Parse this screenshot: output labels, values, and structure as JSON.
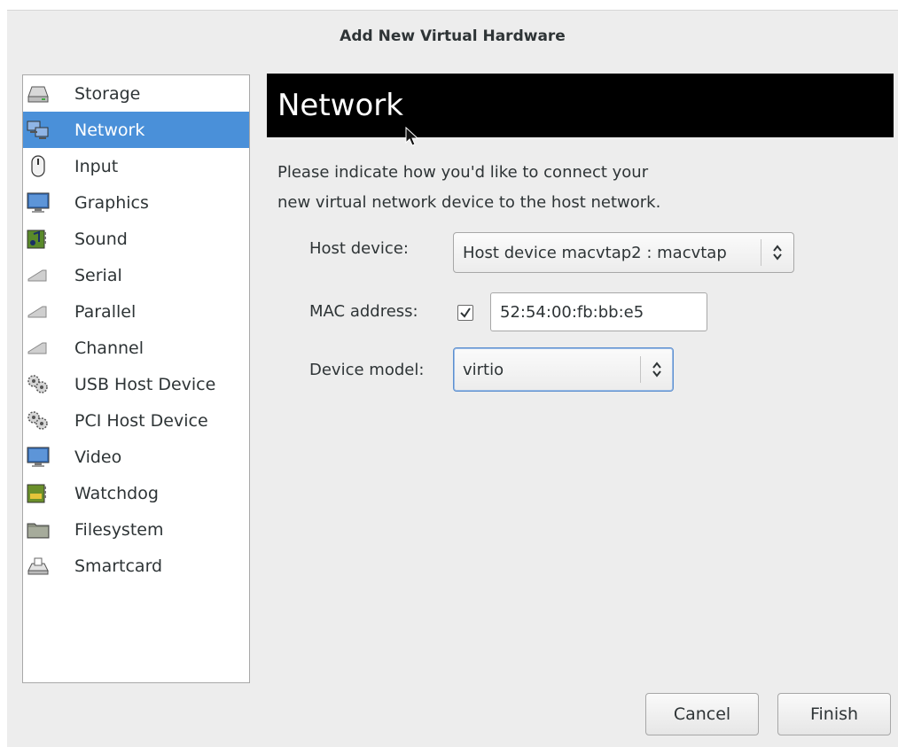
{
  "window": {
    "title": "Add New Virtual Hardware"
  },
  "sidebar": {
    "selected_index": 1,
    "items": [
      {
        "label": "Storage",
        "icon": "storage-icon"
      },
      {
        "label": "Network",
        "icon": "network-icon"
      },
      {
        "label": "Input",
        "icon": "mouse-icon"
      },
      {
        "label": "Graphics",
        "icon": "monitor-icon"
      },
      {
        "label": "Sound",
        "icon": "sound-card-icon"
      },
      {
        "label": "Serial",
        "icon": "serial-plug-icon"
      },
      {
        "label": "Parallel",
        "icon": "parallel-plug-icon"
      },
      {
        "label": "Channel",
        "icon": "channel-plug-icon"
      },
      {
        "label": "USB Host Device",
        "icon": "usb-gears-icon"
      },
      {
        "label": "PCI Host Device",
        "icon": "pci-gears-icon"
      },
      {
        "label": "Video",
        "icon": "video-monitor-icon"
      },
      {
        "label": "Watchdog",
        "icon": "watchdog-card-icon"
      },
      {
        "label": "Filesystem",
        "icon": "folder-icon"
      },
      {
        "label": "Smartcard",
        "icon": "smartcard-icon"
      }
    ]
  },
  "main": {
    "heading": "Network",
    "description_line1": "Please indicate how you'd like to connect your",
    "description_line2": "new virtual network device to the host network.",
    "host_device": {
      "label": "Host device:",
      "value": "Host device macvtap2 : macvtap"
    },
    "mac_address": {
      "label": "MAC address:",
      "checked": true,
      "value": "52:54:00:fb:bb:e5"
    },
    "device_model": {
      "label": "Device model:",
      "value": "virtio"
    }
  },
  "buttons": {
    "cancel": "Cancel",
    "finish": "Finish"
  },
  "colors": {
    "selection": "#4a90d9",
    "banner_bg": "#000000",
    "window_bg": "#ededed"
  }
}
